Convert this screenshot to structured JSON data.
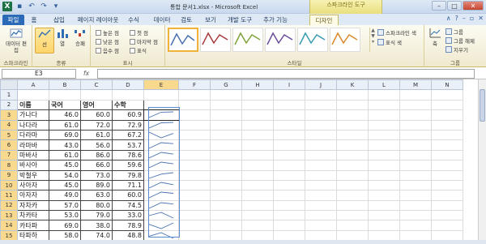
{
  "window": {
    "title": "통합 문서1.xlsx - Microsoft Excel",
    "context_tab_header": "스파크라인 도구"
  },
  "tabs": [
    "파일",
    "홈",
    "삽입",
    "페이지 레이아웃",
    "수식",
    "데이터",
    "검토",
    "보기",
    "개발 도구",
    "추가 기능",
    "디자인"
  ],
  "ribbon": {
    "sparkline_group": {
      "label": "스파크라인",
      "edit_data": "데이터 편집"
    },
    "type_group": {
      "label": "종류",
      "line": "선",
      "column": "열",
      "win_loss": "승패"
    },
    "show_group": {
      "label": "표시",
      "checks": [
        "높은 점",
        "첫 점",
        "낮은 점",
        "마지막 점",
        "음수 점",
        "표식"
      ]
    },
    "style_group": {
      "label": "스타일",
      "sparkline_color": "스파크라인 색",
      "marker_color": "표식 색"
    },
    "group_group": {
      "label": "그룹",
      "axis": "축",
      "group": "그룹",
      "ungroup": "그룹 해제",
      "clear": "지우기"
    }
  },
  "formula_bar": {
    "name_box": "E3",
    "fx": "fx",
    "value": ""
  },
  "colors": {
    "accent_tab": "#2a6ab7",
    "context_yellow": "#f7f2b3",
    "selection_orange": "#f0b23b"
  },
  "sheet": {
    "columns": [
      "A",
      "B",
      "C",
      "D",
      "E",
      "F",
      "G",
      "H",
      "I",
      "J",
      "K",
      "L",
      "M",
      "N"
    ],
    "headers": [
      "이름",
      "국어",
      "영어",
      "수학"
    ],
    "rows": [
      [
        "가나다",
        "46.0",
        "60.0",
        "60.9"
      ],
      [
        "나다라",
        "61.0",
        "72.0",
        "72.9"
      ],
      [
        "다라마",
        "69.0",
        "61.0",
        "67.2"
      ],
      [
        "라마바",
        "43.0",
        "56.0",
        "53.7"
      ],
      [
        "마바사",
        "61.0",
        "86.0",
        "78.6"
      ],
      [
        "바사아",
        "45.0",
        "66.0",
        "59.6"
      ],
      [
        "박철우",
        "54.0",
        "73.0",
        "79.8"
      ],
      [
        "사아자",
        "45.0",
        "89.0",
        "71.1"
      ],
      [
        "아자자",
        "49.0",
        "63.0",
        "60.0"
      ],
      [
        "자차카",
        "57.0",
        "80.0",
        "74.5"
      ],
      [
        "차카타",
        "53.0",
        "79.0",
        "33.0"
      ],
      [
        "카타파",
        "69.0",
        "38.0",
        "78.9"
      ],
      [
        "타파하",
        "58.0",
        "74.0",
        "48.8"
      ]
    ],
    "row_numbers": [
      "1",
      "2",
      "3",
      "4",
      "5",
      "6",
      "7",
      "8",
      "9",
      "10",
      "11",
      "12",
      "13",
      "14",
      "15"
    ]
  }
}
